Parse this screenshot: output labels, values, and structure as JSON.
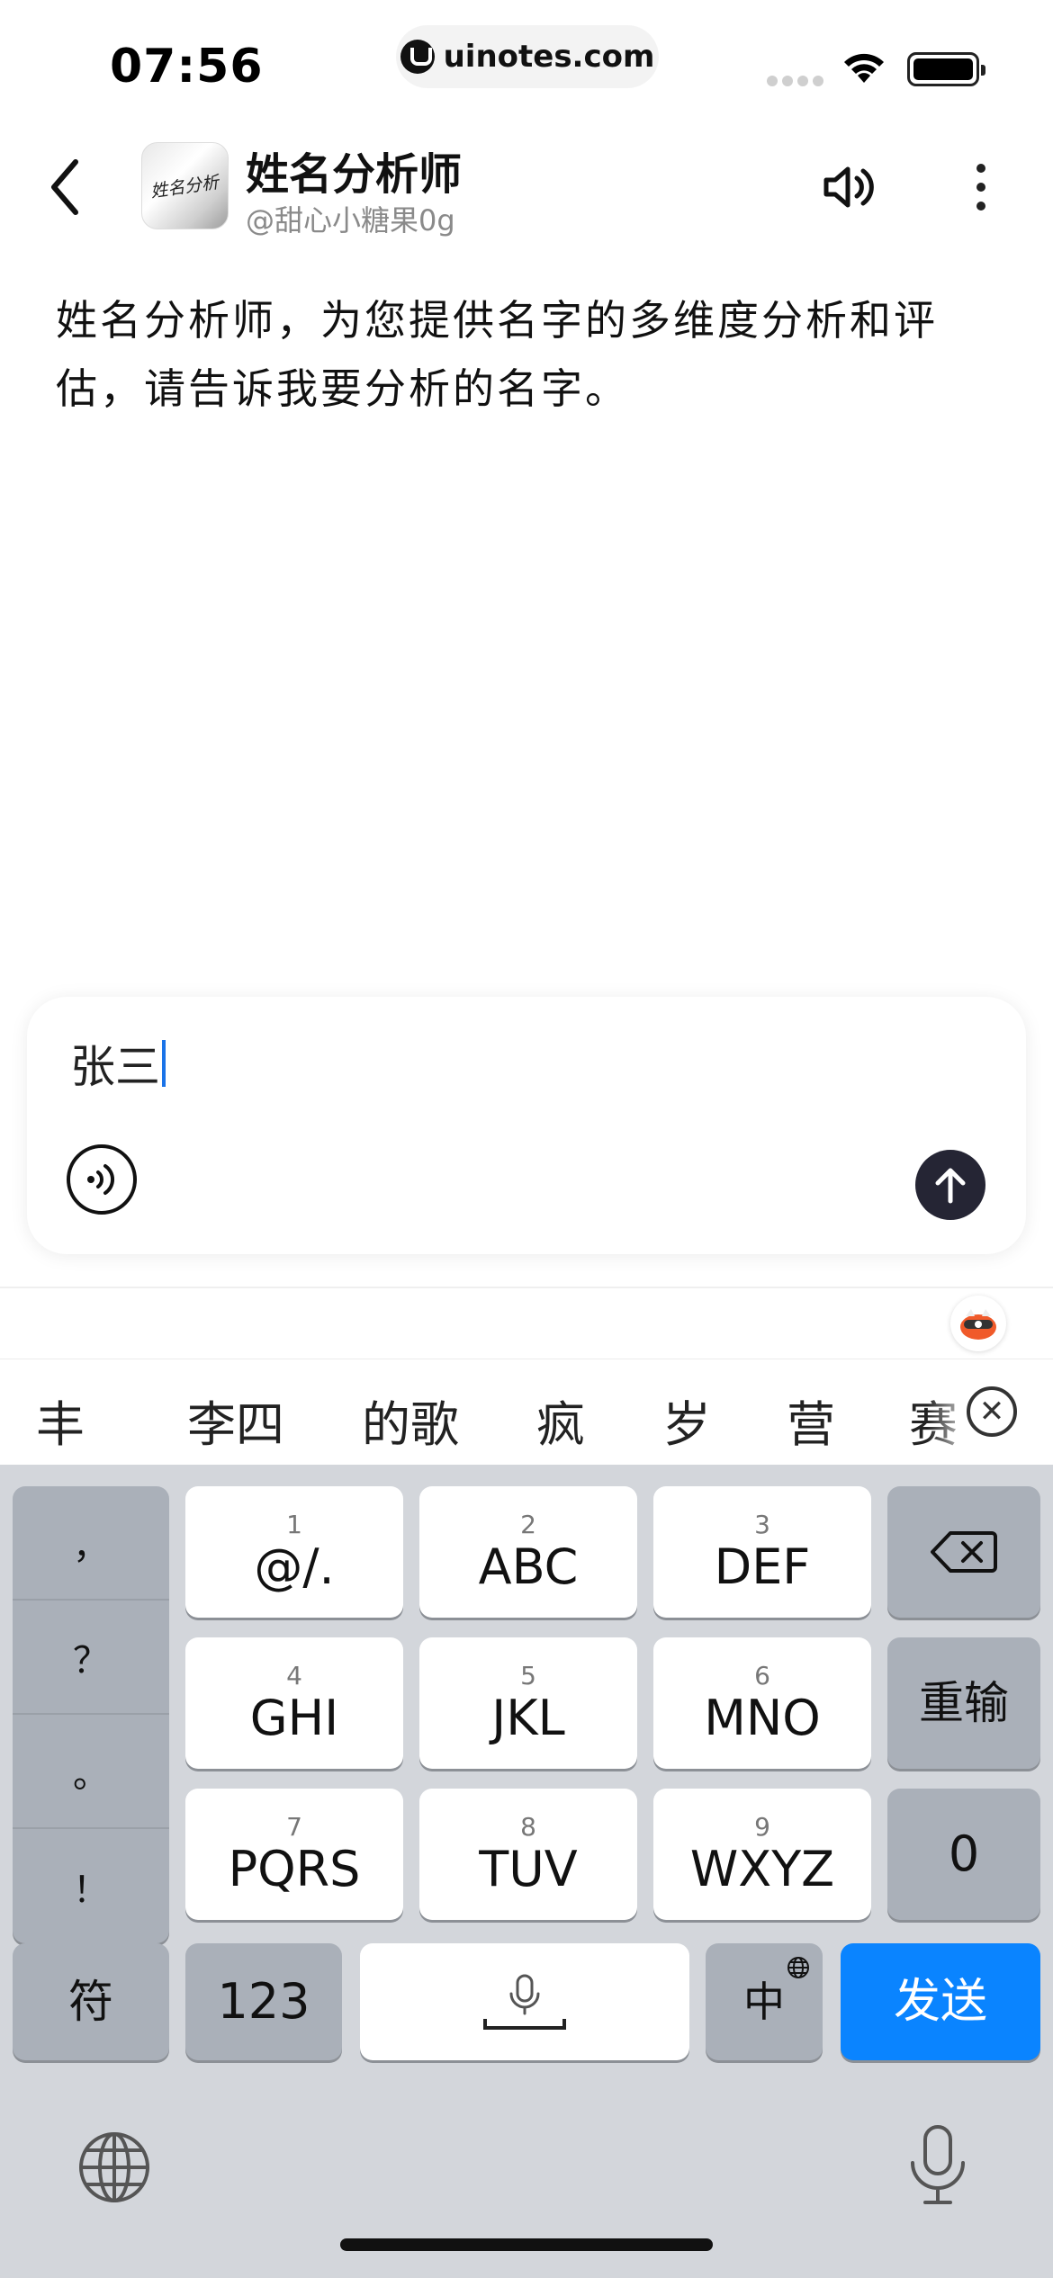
{
  "status_bar": {
    "time": "07:56",
    "url": "uinotes.com"
  },
  "header": {
    "bot_name": "姓名分析师",
    "bot_handle": "@甜心小糖果0g",
    "avatar_text": "姓名分析"
  },
  "message": {
    "text": "姓名分析师，为您提供名字的多维度分析和评估，请告诉我要分析的名字。"
  },
  "input": {
    "value": "张三"
  },
  "candidates": [
    "丰",
    "李四",
    "的歌",
    "疯",
    "岁",
    "营",
    "赛"
  ],
  "keyboard": {
    "punctuation": [
      "，",
      "？",
      "。",
      "！"
    ],
    "rows": [
      [
        {
          "num": "1",
          "label": "@/."
        },
        {
          "num": "2",
          "label": "ABC"
        },
        {
          "num": "3",
          "label": "DEF"
        }
      ],
      [
        {
          "num": "4",
          "label": "GHI"
        },
        {
          "num": "5",
          "label": "JKL"
        },
        {
          "num": "6",
          "label": "MNO"
        }
      ],
      [
        {
          "num": "7",
          "label": "PQRS"
        },
        {
          "num": "8",
          "label": "TUV"
        },
        {
          "num": "9",
          "label": "WXYZ"
        }
      ]
    ],
    "reenter_label": "重输",
    "zero_label": "0",
    "symbols_label": "符",
    "numbers_label": "123",
    "lang_label": "中",
    "send_label": "发送"
  },
  "colors": {
    "send_key": "#0a84ff",
    "send_arrow_button": "#252534",
    "keyboard_bg": "#d3d6db"
  }
}
